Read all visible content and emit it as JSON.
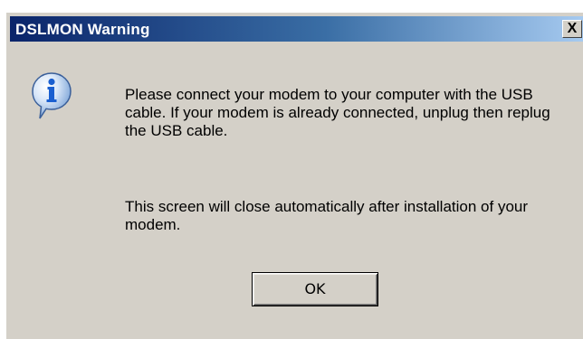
{
  "window": {
    "title": "DSLMON Warning",
    "close_label": "X"
  },
  "message": {
    "paragraph1": "Please connect your modem to your computer with the USB cable. If your modem is already connected, unplug then replug the USB cable.",
    "paragraph2": "This screen will close automatically after installation of your modem."
  },
  "buttons": {
    "ok_label": "OK"
  },
  "icon": {
    "name": "info-icon"
  },
  "colors": {
    "titlebar_start": "#0a246a",
    "titlebar_end": "#a6caf0",
    "dialog_background": "#d4d0c8",
    "icon_blue": "#1a5fd0"
  }
}
